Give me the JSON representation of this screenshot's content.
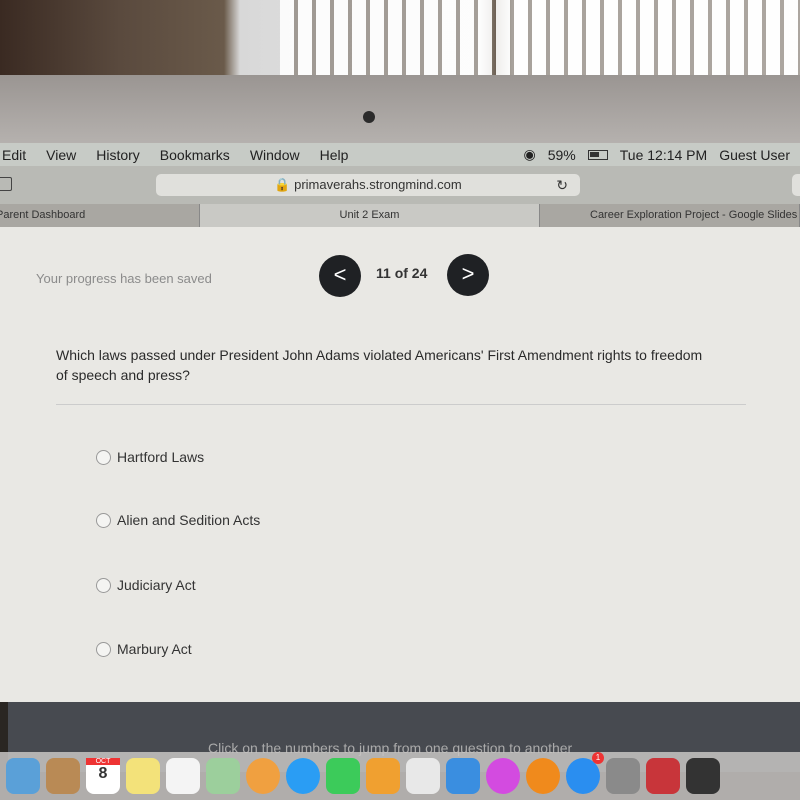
{
  "menubar": {
    "items": [
      "Edit",
      "View",
      "History",
      "Bookmarks",
      "Window",
      "Help"
    ],
    "battery": "59%",
    "clock": "Tue 12:14 PM",
    "user": "Guest User"
  },
  "browser": {
    "url": "primaverahs.strongmind.com",
    "tabs": [
      "Parent Dashboard",
      "Unit 2 Exam",
      "Career Exploration Project - Google Slides"
    ]
  },
  "exam": {
    "saved": "Your progress has been saved",
    "prev": "<",
    "next": ">",
    "counter": "11 of 24",
    "question": "Which laws passed under President John Adams violated Americans' First Amendment rights to freedom of speech and press?",
    "options": [
      "Hartford Laws",
      "Alien and Sedition Acts",
      "Judiciary Act",
      "Marbury Act"
    ],
    "hint": "Click on the numbers to jump from one question to another"
  },
  "dock": {
    "calendar_month": "OCT",
    "calendar_day": "8",
    "appstore_badge": "1",
    "apps": [
      "preview",
      "contacts",
      "calendar",
      "notes",
      "reminders",
      "maps",
      "photos",
      "messages",
      "facetime",
      "pages",
      "numbers",
      "keynote",
      "itunes",
      "ibooks",
      "app-store",
      "system-preferences",
      "photo-booth",
      "garageband"
    ],
    "colors": [
      "#5aa0d8",
      "#b98a55",
      "#ffffff",
      "#f3e27a",
      "#f4f4f4",
      "#9ccf9c",
      "#f0a040",
      "#2a9df4",
      "#3ccb5a",
      "#f0a030",
      "#e8e8e8",
      "#3a8ee0",
      "#d34be0",
      "#f08a1c",
      "#2a8ef0",
      "#8a8a8a",
      "#c8353a",
      "#333333"
    ]
  }
}
